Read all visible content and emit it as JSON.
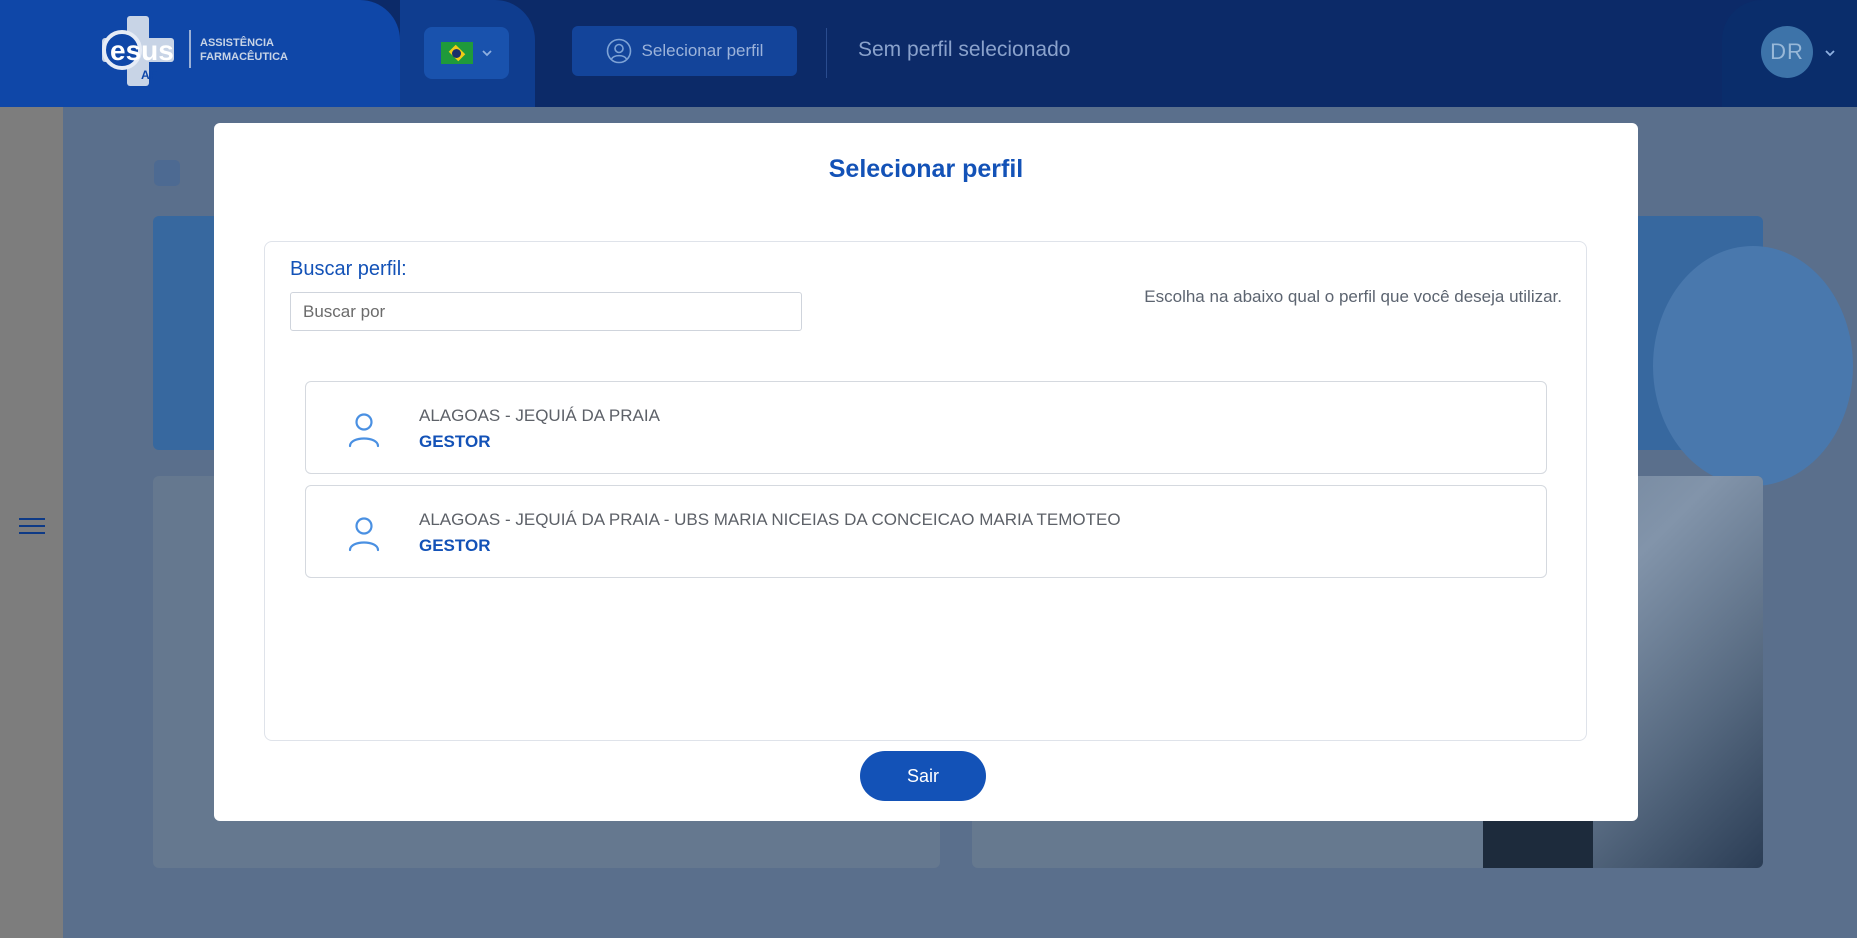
{
  "header": {
    "logo": {
      "brand": "esus",
      "sub": "AF",
      "line1": "ASSISTÊNCIA",
      "line2": "FARMACÊUTICA"
    },
    "language": {
      "flag": "brazil-flag",
      "icon": "chevron-down-icon"
    },
    "select_profile_label": "Selecionar perfil",
    "current_profile": "Sem perfil selecionado",
    "user_initials": "DR"
  },
  "modal": {
    "title": "Selecionar perfil",
    "search_label": "Buscar perfil:",
    "search_placeholder": "Buscar por",
    "search_value": "",
    "hint": "Escolha na abaixo qual o perfil que você deseja utilizar.",
    "profiles": [
      {
        "name": "ALAGOAS - JEQUIÁ DA PRAIA",
        "role": "GESTOR"
      },
      {
        "name": "ALAGOAS - JEQUIÁ DA PRAIA - UBS MARIA NICEIAS DA CONCEICAO MARIA TEMOTEO",
        "role": "GESTOR"
      }
    ],
    "exit_label": "Sair"
  },
  "colors": {
    "primary": "#1352b7",
    "header_bg": "#0c2a68",
    "overlay": "#5a6f8c"
  }
}
